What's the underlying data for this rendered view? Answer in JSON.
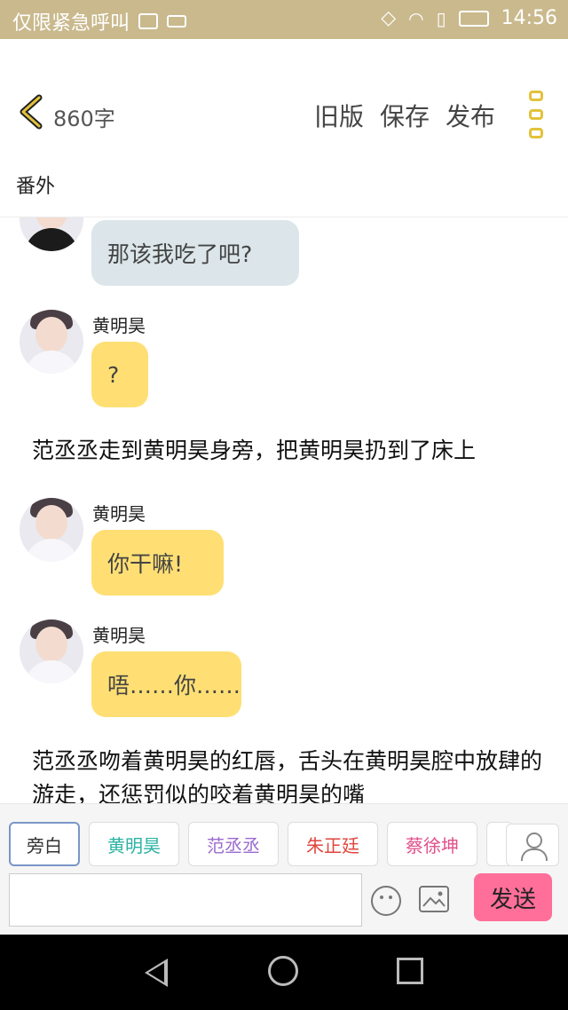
{
  "status_bar": {
    "carrier": "仅限紧急呼叫",
    "time": "14:56"
  },
  "header": {
    "word_count": "860字",
    "old_version": "旧版",
    "save": "保存",
    "publish": "发布"
  },
  "chapter_title": "番外",
  "messages": [
    {
      "speaker": "",
      "text": "那该我吃了吧?"
    },
    {
      "speaker": "黄明昊",
      "text": "?"
    },
    {
      "narration": "范丞丞走到黄明昊身旁，把黄明昊扔到了床上"
    },
    {
      "speaker": "黄明昊",
      "text": "你干嘛!"
    },
    {
      "speaker": "黄明昊",
      "text": "唔……你……"
    },
    {
      "narration": "范丞丞吻着黄明昊的红唇，舌头在黄明昊腔中放肆的游走，还惩罚似的咬着黄明昊的嘴"
    }
  ],
  "roles": [
    "旁白",
    "黄明昊",
    "范丞丞",
    "朱正廷",
    "蔡徐坤"
  ],
  "role_colors": [
    "#333333",
    "#2bb3a3",
    "#9b6bd1",
    "#e0463e",
    "#e04f8a"
  ],
  "send_label": "发送",
  "colors": {
    "accent": "#e2c23b",
    "bubble_yellow": "#ffdf74",
    "bubble_gray": "#dce6ea",
    "send": "#ff6f9a",
    "statusbar": "#c9b98d"
  }
}
